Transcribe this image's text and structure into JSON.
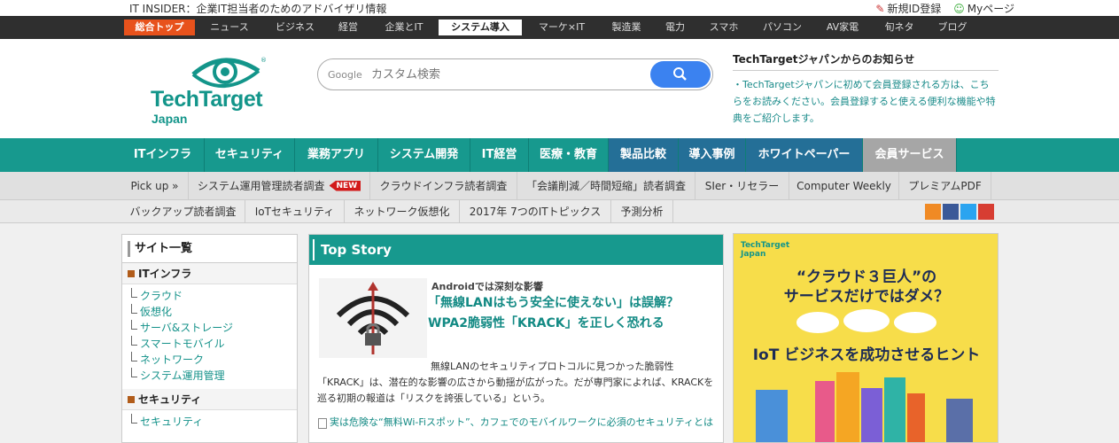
{
  "topbar": {
    "tagline": "IT INSIDER：企業IT担当者のためのアドバイザリ情報",
    "register": "新規ID登録",
    "mypage": "Myページ"
  },
  "darkbar": {
    "items": [
      "総合トップ",
      "ニュース",
      "ビジネス",
      "経営",
      "企業とIT",
      "システム導入",
      "マーケ×IT",
      "製造業",
      "電力",
      "スマホ",
      "パソコン",
      "AV家電",
      "旬ネタ",
      "ブログ"
    ],
    "active": "システム導入"
  },
  "header": {
    "logo_main": "TechTarget",
    "logo_sub": "Japan",
    "search_brand": "Google",
    "search_placeholder": "カスタム検索"
  },
  "notice": {
    "title": "TechTargetジャパンからのお知らせ",
    "body": "・TechTargetジャパンに初めて会員登録される方は、こちらをお読みください。会員登録すると使える便利な機能や特典をご紹介します。"
  },
  "mainnav": [
    "ITインフラ",
    "セキュリティ",
    "業務アプリ",
    "システム開発",
    "IT経営",
    "医療・教育",
    "製品比較",
    "導入事例",
    "ホワイトペーパー",
    "会員サービス"
  ],
  "subnav1": [
    "Pick up »",
    "システム運用管理読者調査",
    "クラウドインフラ読者調査",
    "「会議削減／時間短縮」読者調査",
    "SIer・リセラー",
    "Computer Weekly",
    "プレミアムPDF"
  ],
  "new_badge": "NEW",
  "subnav2": [
    "バックアップ読者調査",
    "IoTセキュリティ",
    "ネットワーク仮想化",
    "2017年 7つのITトピックス",
    "予測分析"
  ],
  "sidebar": {
    "title": "サイト一覧",
    "cat1": "ITインフラ",
    "items1": [
      "クラウド",
      "仮想化",
      "サーバ&ストレージ",
      "スマートモバイル",
      "ネットワーク",
      "システム運用管理"
    ],
    "cat2": "セキュリティ",
    "items2": [
      "セキュリティ"
    ]
  },
  "topstory": {
    "header": "Top Story",
    "kicker": "Androidでは深刻な影響",
    "headline": "「無線LANはもう安全に使えない」は誤解？　WPA2脆弱性「KRACK」を正しく恐れる",
    "summary": "無線LANのセキュリティプロトコルに見つかった脆弱性「KRACK」は、潜在的な影響の広さから動揺が広がった。だが専門家によれば、KRACKを巡る初期の報道は「リスクを誇張している」という。",
    "related": "実は危険な“無料Wi-Fiスポット”、カフェでのモバイルワークに必須のセキュリティとは"
  },
  "ad": {
    "logo_main": "TechTarget",
    "logo_sub": "Japan",
    "line1": "“クラウド３巨人”の",
    "line2": "サービスだけではダメ？",
    "line3": "IoT ビジネスを成功させるヒント"
  },
  "colors": {
    "teal": "#17998e",
    "blue": "#246f97",
    "orange": "#e8521c",
    "ad_yellow": "#f7dd4a"
  }
}
